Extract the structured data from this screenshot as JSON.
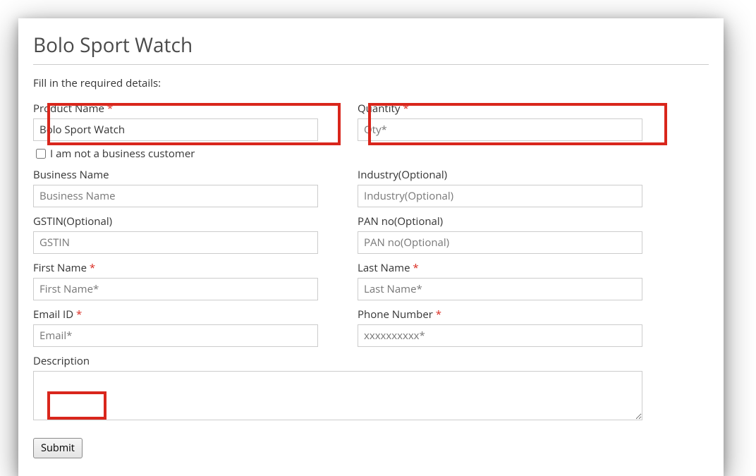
{
  "title": "Bolo Sport Watch",
  "intro": "Fill in the required details:",
  "fields": {
    "productName": {
      "label": "Product Name",
      "required": true,
      "value": "Bolo Sport Watch",
      "placeholder": ""
    },
    "quantity": {
      "label": "Quantity",
      "required": true,
      "value": "",
      "placeholder": "Qty*"
    },
    "notBusiness": {
      "label": "I am not a business customer",
      "checked": false
    },
    "businessName": {
      "label": "Business Name",
      "required": false,
      "value": "",
      "placeholder": "Business Name"
    },
    "industry": {
      "label": "Industry(Optional)",
      "required": false,
      "value": "",
      "placeholder": "Industry(Optional)"
    },
    "gstin": {
      "label": "GSTIN(Optional)",
      "required": false,
      "value": "",
      "placeholder": "GSTIN"
    },
    "pan": {
      "label": "PAN no(Optional)",
      "required": false,
      "value": "",
      "placeholder": "PAN no(Optional)"
    },
    "firstName": {
      "label": "First Name",
      "required": true,
      "value": "",
      "placeholder": "First Name*"
    },
    "lastName": {
      "label": "Last Name",
      "required": true,
      "value": "",
      "placeholder": "Last Name*"
    },
    "email": {
      "label": "Email ID",
      "required": true,
      "value": "",
      "placeholder": "Email*"
    },
    "phone": {
      "label": "Phone Number",
      "required": true,
      "value": "",
      "placeholder": "xxxxxxxxxx*"
    },
    "description": {
      "label": "Description",
      "required": false,
      "value": "",
      "placeholder": ""
    }
  },
  "submit": "Submit",
  "asterisk": "*"
}
